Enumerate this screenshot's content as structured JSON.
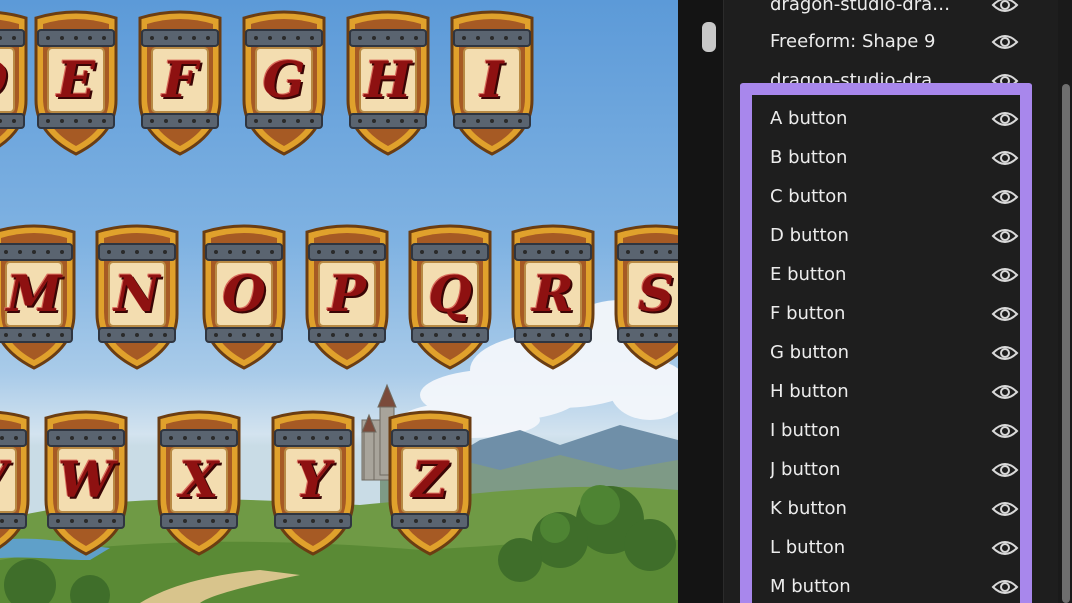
{
  "canvas": {
    "rows": [
      {
        "letters": [
          "D",
          "E",
          "F",
          "G",
          "H",
          "I"
        ]
      },
      {
        "letters": [
          "M",
          "N",
          "O",
          "P",
          "Q",
          "R",
          "S"
        ]
      },
      {
        "letters": [
          "V",
          "W",
          "X",
          "Y",
          "Z"
        ]
      }
    ]
  },
  "layers_panel": {
    "layers": [
      {
        "name": "dragon-studio-dra…",
        "icon": "eye-icon"
      },
      {
        "name": "Freeform: Shape 9",
        "icon": "eye-icon"
      },
      {
        "name": "dragon-studio-dra",
        "icon": "eye-icon"
      },
      {
        "name": "A button",
        "icon": "eye-icon"
      },
      {
        "name": "B button",
        "icon": "eye-icon"
      },
      {
        "name": "C button",
        "icon": "eye-icon"
      },
      {
        "name": "D button",
        "icon": "eye-icon"
      },
      {
        "name": "E button",
        "icon": "eye-icon"
      },
      {
        "name": "F button",
        "icon": "eye-icon"
      },
      {
        "name": "G button",
        "icon": "eye-icon"
      },
      {
        "name": "H button",
        "icon": "eye-icon"
      },
      {
        "name": "I button",
        "icon": "eye-icon"
      },
      {
        "name": "J button",
        "icon": "eye-icon"
      },
      {
        "name": "K button",
        "icon": "eye-icon"
      },
      {
        "name": "L button",
        "icon": "eye-icon"
      },
      {
        "name": "M button",
        "icon": "eye-icon"
      }
    ],
    "selection_color": "#a887ec"
  }
}
